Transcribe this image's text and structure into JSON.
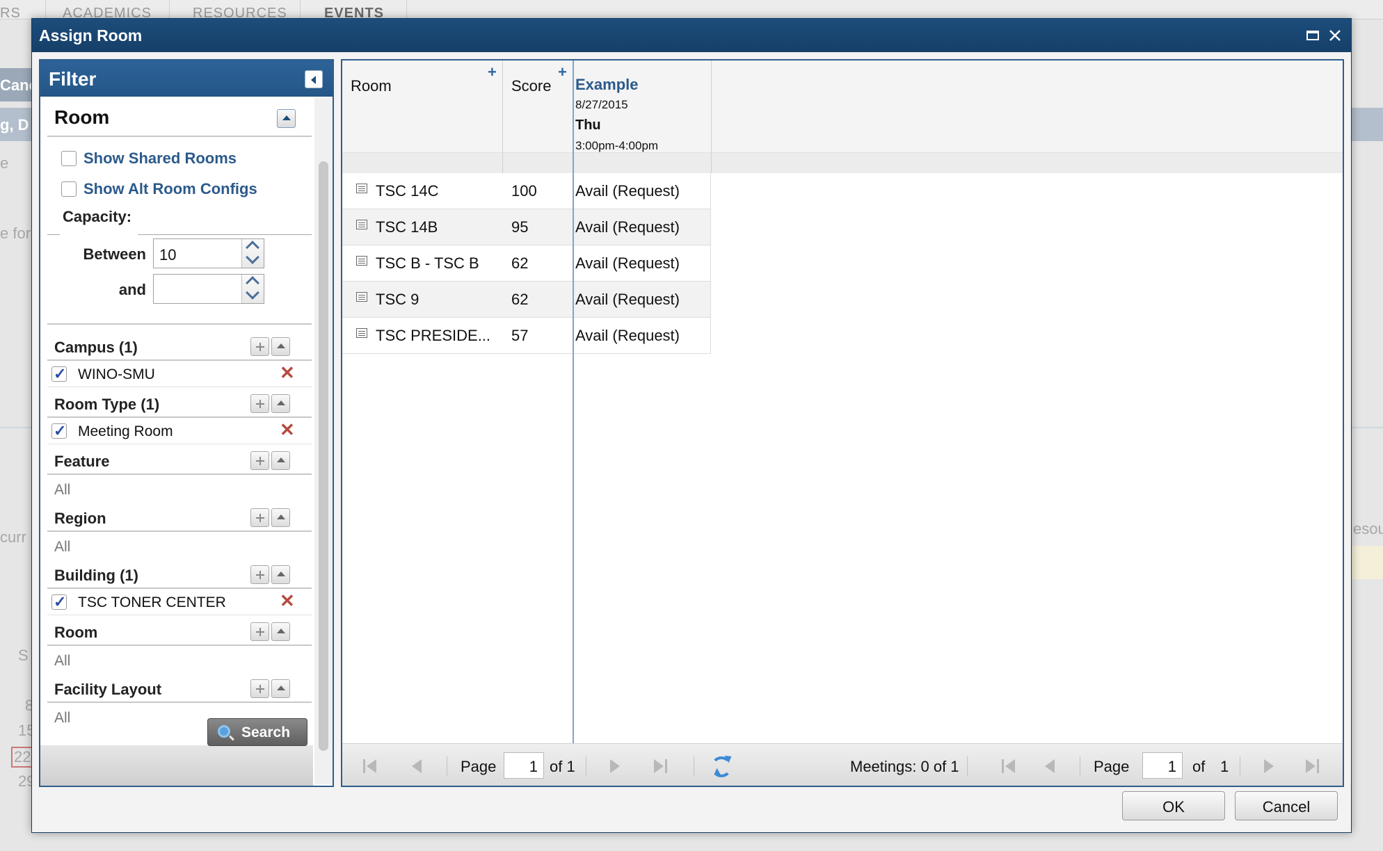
{
  "background": {
    "tabs": [
      "RS",
      "ACADEMICS",
      "RESOURCES",
      "EVENTS"
    ],
    "fragments": [
      "Canc",
      "g, D",
      "e",
      "e for",
      "curr",
      "S",
      "8",
      "15",
      "22",
      "29",
      "esou"
    ]
  },
  "modal": {
    "title": "Assign Room",
    "buttons": {
      "ok": "OK",
      "cancel": "Cancel"
    }
  },
  "filter": {
    "title": "Filter",
    "section": "Room",
    "show_shared": "Show Shared Rooms",
    "show_alt": "Show Alt Room Configs",
    "capacity": {
      "label": "Capacity:",
      "between_label": "Between",
      "between_value": "10",
      "and_label": "and",
      "and_value": ""
    },
    "groups": {
      "campus": {
        "title": "Campus (1)",
        "item": "WINO-SMU"
      },
      "room_type": {
        "title": "Room Type (1)",
        "item": "Meeting Room"
      },
      "feature": {
        "title": "Feature",
        "all": "All"
      },
      "region": {
        "title": "Region",
        "all": "All"
      },
      "building": {
        "title": "Building (1)",
        "item": "TSC TONER CENTER"
      },
      "room": {
        "title": "Room",
        "all": "All"
      },
      "facility": {
        "title": "Facility Layout",
        "all": "All"
      }
    },
    "search_label": "Search"
  },
  "grid": {
    "columns": {
      "room": "Room",
      "score": "Score",
      "plus": "+"
    },
    "example": {
      "title": "Example",
      "date": "8/27/2015",
      "day": "Thu",
      "time": "3:00pm-4:00pm"
    },
    "rows": [
      {
        "room": "TSC 14C",
        "score": "100",
        "avail": "Avail (Request)"
      },
      {
        "room": "TSC 14B",
        "score": "95",
        "avail": "Avail (Request)"
      },
      {
        "room": "TSC B - TSC B",
        "score": "62",
        "avail": "Avail (Request)"
      },
      {
        "room": "TSC 9",
        "score": "62",
        "avail": "Avail (Request)"
      },
      {
        "room": "TSC PRESIDE...",
        "score": "57",
        "avail": "Avail (Request)"
      }
    ],
    "pager": {
      "page_label": "Page",
      "page_value": "1",
      "of_label": "of 1",
      "meetings": "Meetings:  0 of 1",
      "page_value2": "1",
      "of_label2": "of",
      "total2": "1"
    }
  }
}
